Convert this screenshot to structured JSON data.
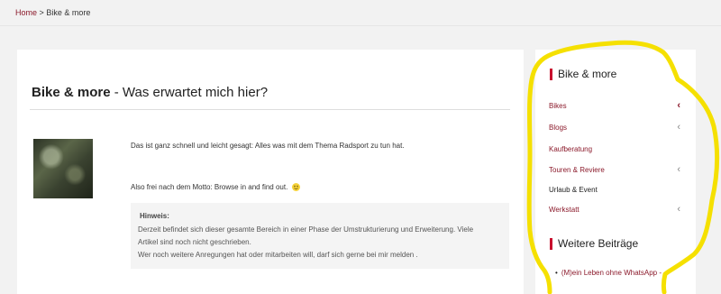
{
  "breadcrumb": {
    "home": "Home",
    "separator": ">",
    "current": "Bike & more"
  },
  "main": {
    "title_bold": "Bike & more",
    "title_rest": " - Was erwartet mich hier?",
    "intro": "Das ist ganz schnell und leicht gesagt: Alles was mit dem Thema Radsport zu tun hat.",
    "motto": "Also frei nach dem Motto: Browse in and find out.",
    "note": {
      "title": "Hinweis:",
      "line1": "Derzeit befindet sich dieser gesamte Bereich in einer Phase der Umstrukturierung und Erweiterung. Viele",
      "line2": "Artikel sind noch nicht geschrieben.",
      "line3": "Wer noch weitere Anregungen hat oder mitarbeiten will, darf sich gerne bei mir melden ."
    }
  },
  "sidebar": {
    "widget_title": "Bike & more",
    "items": [
      {
        "label": "Bikes",
        "has_submenu": true,
        "active": true
      },
      {
        "label": "Blogs",
        "has_submenu": true,
        "active": false
      },
      {
        "label": "Kaufberatung",
        "has_submenu": false,
        "active": false
      },
      {
        "label": "Touren & Reviere",
        "has_submenu": true,
        "active": false
      },
      {
        "label": "Urlaub & Event",
        "has_submenu": false,
        "active": false
      },
      {
        "label": "Werkstatt",
        "has_submenu": true,
        "active": false
      }
    ],
    "posts_title": "Weitere Beiträge",
    "posts": [
      {
        "label": "(M)ein Leben ohne WhatsApp -"
      }
    ]
  },
  "colors": {
    "accent": "#c8102e",
    "link": "#8b1a2b",
    "highlight": "#f5e000"
  },
  "icons": {
    "chevron": "chevron-left-icon",
    "smiley": "smiley-icon",
    "bullet": "bullet-icon"
  }
}
